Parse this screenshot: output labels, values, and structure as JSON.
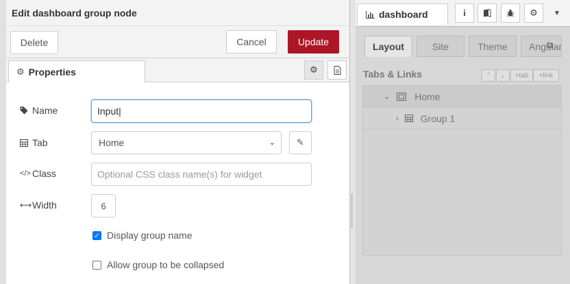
{
  "tray": {
    "title": "Edit dashboard group node",
    "delete_label": "Delete",
    "cancel_label": "Cancel",
    "update_label": "Update",
    "properties_tab": "Properties"
  },
  "form": {
    "name_label": "Name",
    "name_value": "Input",
    "tab_label": "Tab",
    "tab_value": "Home",
    "class_label": "Class",
    "class_placeholder": "Optional CSS class name(s) for widget",
    "width_label": "Width",
    "width_value": "6",
    "display_group_name_label": "Display group name",
    "display_group_name_checked": true,
    "allow_collapse_label": "Allow group to be collapsed",
    "allow_collapse_checked": false
  },
  "sidebar": {
    "tab_label": "dashboard",
    "dash_tabs": [
      "Layout",
      "Site",
      "Theme",
      "Angular"
    ],
    "active_dash_tab": "Layout",
    "tabs_links_title": "Tabs & Links",
    "mini_buttons": {
      "up": "⌃",
      "down": "⌄",
      "tab": "+tab",
      "link": "+link"
    },
    "tree": [
      {
        "label": "Home",
        "type": "tab",
        "expanded": true
      },
      {
        "label": "Group 1",
        "type": "group",
        "expanded": false
      }
    ]
  },
  "icons": {
    "tag": "tag-icon",
    "table": "table-icon",
    "code": "code-icon",
    "arrows": "width-arrows-icon",
    "gear": "gear-icon",
    "doc": "document-icon",
    "pencil": "pencil-icon",
    "info": "info-icon",
    "book": "book-icon",
    "bug": "bug-icon",
    "chevron": "chevron-down-icon",
    "chart": "bar-chart-icon",
    "external": "external-link-icon"
  },
  "colors": {
    "update_button": "#ad1625",
    "checkbox_checked": "#0075ff",
    "focus_border": "#6aa0d8"
  }
}
